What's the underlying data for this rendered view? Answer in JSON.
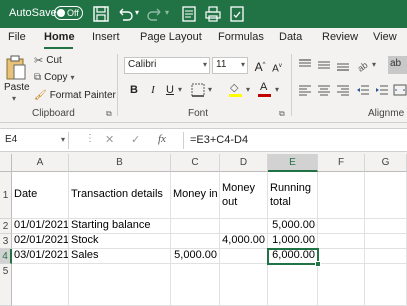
{
  "titlebar": {
    "autosave_label": "AutoSave",
    "autosave_state": "Off",
    "bg_color": "#217346"
  },
  "tabs": [
    "File",
    "Home",
    "Insert",
    "Page Layout",
    "Formulas",
    "Data",
    "Review",
    "View"
  ],
  "ribbon": {
    "clipboard": {
      "paste_label": "Paste",
      "cut_label": "Cut",
      "copy_label": "Copy",
      "format_painter_label": "Format Painter",
      "group_label": "Clipboard"
    },
    "font": {
      "font_name": "Calibri",
      "font_size": "11",
      "grow_label": "A",
      "shrink_label": "A",
      "bold": "B",
      "italic": "I",
      "underline": "U",
      "group_label": "Font",
      "font_color": "#c00000",
      "highlight_color": "#ffff00"
    },
    "alignment": {
      "group_label": "Alignme"
    }
  },
  "formula_bar": {
    "name_box": "E4",
    "formula": "=E3+C4-D4",
    "fx_label": "fx"
  },
  "sheet": {
    "columns": [
      "A",
      "B",
      "C",
      "D",
      "E",
      "F",
      "G"
    ],
    "rows": [
      "1",
      "2",
      "3",
      "4",
      "5"
    ],
    "selected_cell": "E4",
    "headers": {
      "date": "Date",
      "details": "Transaction details",
      "money_in": "Money in",
      "money_out": "Money out",
      "running_total": "Running total"
    },
    "data": [
      {
        "date": "01/01/2021",
        "details": "Starting balance",
        "money_in": "",
        "money_out": "",
        "running_total": "5,000.00"
      },
      {
        "date": "02/01/2021",
        "details": "Stock",
        "money_in": "",
        "money_out": "4,000.00",
        "running_total": "1,000.00"
      },
      {
        "date": "03/01/2021",
        "details": "Sales",
        "money_in": "5,000.00",
        "money_out": "",
        "running_total": "6,000.00"
      }
    ]
  }
}
